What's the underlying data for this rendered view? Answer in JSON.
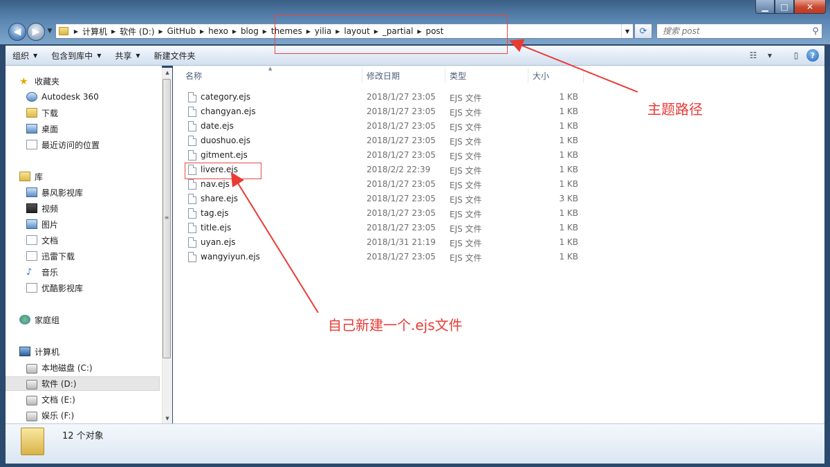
{
  "window": {
    "controls": {
      "minimize": "▁",
      "maximize": "□",
      "close": "✕"
    }
  },
  "nav_buttons": {
    "back": "◀",
    "forward": "▶",
    "history": "▼"
  },
  "address_bar": {
    "breadcrumbs": [
      "计算机",
      "软件 (D:)",
      "GitHub",
      "hexo",
      "blog",
      "themes",
      "yilia",
      "layout",
      "_partial",
      "post"
    ]
  },
  "search": {
    "placeholder": "搜索 post"
  },
  "command_bar": {
    "organize": "组织",
    "include_in_library": "包含到库中",
    "share": "共享",
    "new_folder": "新建文件夹"
  },
  "navigation": {
    "favorites": {
      "label": "收藏夹",
      "items": [
        "Autodesk 360",
        "下载",
        "桌面",
        "最近访问的位置"
      ]
    },
    "libraries": {
      "label": "库",
      "items": [
        "暴风影视库",
        "视频",
        "图片",
        "文档",
        "迅雷下载",
        "音乐",
        "优酷影视库"
      ]
    },
    "homegroup": {
      "label": "家庭组"
    },
    "computer": {
      "label": "计算机",
      "items": [
        "本地磁盘 (C:)",
        "软件 (D:)",
        "文档 (E:)",
        "娱乐 (F:)"
      ],
      "selected": "软件 (D:)"
    }
  },
  "file_list": {
    "columns": {
      "name": "名称",
      "modified": "修改日期",
      "type": "类型",
      "size": "大小"
    },
    "files": [
      {
        "name": "category.ejs",
        "modified": "2018/1/27 23:05",
        "type": "EJS 文件",
        "size": "1 KB"
      },
      {
        "name": "changyan.ejs",
        "modified": "2018/1/27 23:05",
        "type": "EJS 文件",
        "size": "1 KB"
      },
      {
        "name": "date.ejs",
        "modified": "2018/1/27 23:05",
        "type": "EJS 文件",
        "size": "1 KB"
      },
      {
        "name": "duoshuo.ejs",
        "modified": "2018/1/27 23:05",
        "type": "EJS 文件",
        "size": "1 KB"
      },
      {
        "name": "gitment.ejs",
        "modified": "2018/1/27 23:05",
        "type": "EJS 文件",
        "size": "1 KB"
      },
      {
        "name": "livere.ejs",
        "modified": "2018/2/2 22:39",
        "type": "EJS 文件",
        "size": "1 KB"
      },
      {
        "name": "nav.ejs",
        "modified": "2018/1/27 23:05",
        "type": "EJS 文件",
        "size": "1 KB"
      },
      {
        "name": "share.ejs",
        "modified": "2018/1/27 23:05",
        "type": "EJS 文件",
        "size": "3 KB"
      },
      {
        "name": "tag.ejs",
        "modified": "2018/1/27 23:05",
        "type": "EJS 文件",
        "size": "1 KB"
      },
      {
        "name": "title.ejs",
        "modified": "2018/1/27 23:05",
        "type": "EJS 文件",
        "size": "1 KB"
      },
      {
        "name": "uyan.ejs",
        "modified": "2018/1/31 21:19",
        "type": "EJS 文件",
        "size": "1 KB"
      },
      {
        "name": "wangyiyun.ejs",
        "modified": "2018/1/27 23:05",
        "type": "EJS 文件",
        "size": "1 KB"
      }
    ]
  },
  "details": {
    "item_count": "12 个对象"
  },
  "annotations": {
    "theme_path": "主题路径",
    "new_file": "自己新建一个.ejs文件",
    "color": "#ea3a34"
  }
}
